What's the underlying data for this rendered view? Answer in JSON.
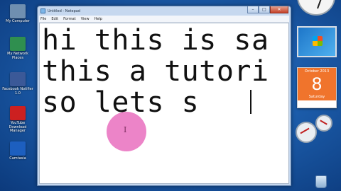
{
  "desktop": {
    "icons": [
      {
        "name": "computer-icon",
        "label": "My Computer",
        "color": "#6f8fb0"
      },
      {
        "name": "network-icon",
        "label": "My Network Places",
        "color": "#2f8f4f"
      },
      {
        "name": "facebook-app-icon",
        "label": "Facebook Notifier 1.0",
        "color": "#3b5998"
      },
      {
        "name": "youtube-app-icon",
        "label": "YouTube Download Manager",
        "color": "#cc2020"
      },
      {
        "name": "camtasia-icon",
        "label": "Camtasia",
        "color": "#1d5fbf"
      }
    ]
  },
  "notepad": {
    "title": "Untitled - Notepad",
    "minimize": "–",
    "maximize": "□",
    "close": "✕",
    "menu": [
      "File",
      "Edit",
      "Format",
      "View",
      "Help"
    ],
    "lines": [
      "hi this is sa",
      "this a tutori",
      "so lets s"
    ]
  },
  "cursor_glyph": "I",
  "gadgets": {
    "calendar": {
      "month": "October 2013",
      "day": "8",
      "weekday": "Saturday"
    }
  },
  "colors": {
    "cursor_highlight": "#e96ebe",
    "calendar": "#f0742c"
  }
}
